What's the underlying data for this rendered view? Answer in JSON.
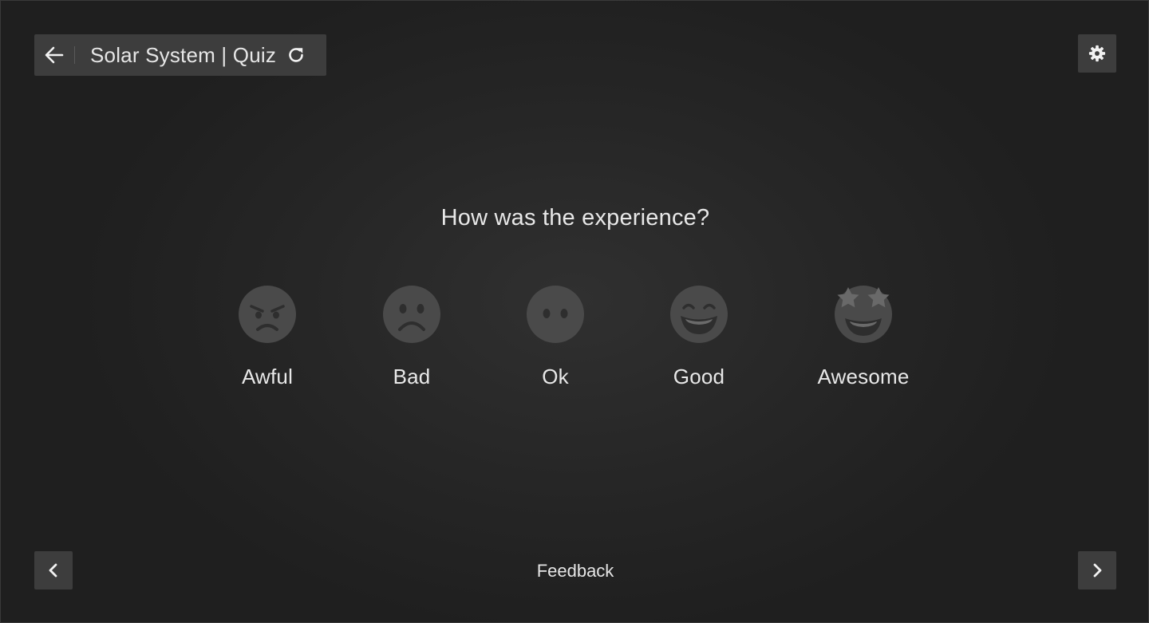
{
  "header": {
    "title": "Solar System | Quiz",
    "back_icon": "arrow-left-icon",
    "reload_icon": "reload-icon",
    "settings_icon": "gear-icon"
  },
  "question": "How was the experience?",
  "ratings": [
    {
      "label": "Awful",
      "icon": "angry-face-icon"
    },
    {
      "label": "Bad",
      "icon": "frowning-face-icon"
    },
    {
      "label": "Ok",
      "icon": "neutral-face-icon"
    },
    {
      "label": "Good",
      "icon": "grinning-face-icon"
    },
    {
      "label": "Awesome",
      "icon": "star-struck-face-icon"
    }
  ],
  "footer": {
    "label": "Feedback",
    "prev_icon": "chevron-left-icon",
    "next_icon": "chevron-right-icon"
  },
  "colors": {
    "background": "#262626",
    "panel": "#3d3d3d",
    "face": "#4a4a4a",
    "face_features": "#2e2e2e",
    "text": "#e8e8e8"
  }
}
